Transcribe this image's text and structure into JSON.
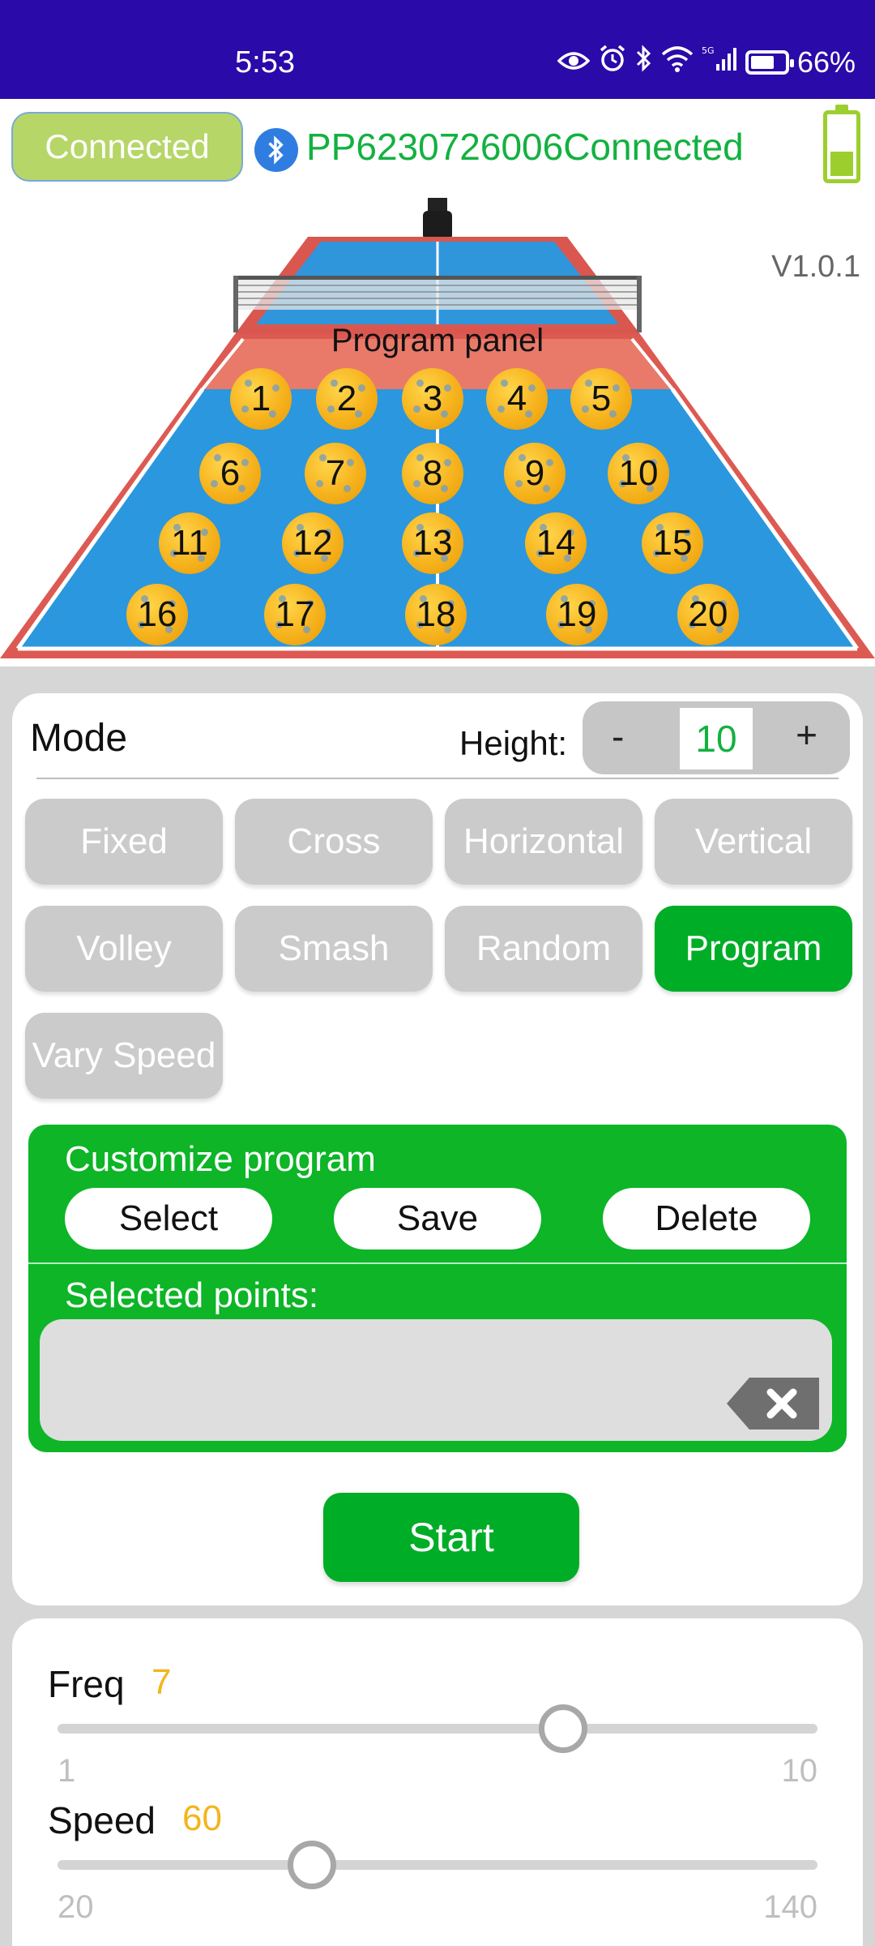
{
  "status_bar": {
    "time": "5:53",
    "battery_percent": "66%",
    "icons": [
      "eye-icon",
      "alarm-icon",
      "bluetooth-icon",
      "wifi-icon",
      "5g-signal-icon",
      "battery-icon"
    ]
  },
  "connection": {
    "status_label": "Connected",
    "device_text": "PP6230726006Connected",
    "battery_level": 0.38
  },
  "court": {
    "version": "V1.0.1",
    "title": "Program panel",
    "points": [
      "1",
      "2",
      "3",
      "4",
      "5",
      "6",
      "7",
      "8",
      "9",
      "10",
      "11",
      "12",
      "13",
      "14",
      "15",
      "16",
      "17",
      "18",
      "19",
      "20"
    ]
  },
  "mode_card": {
    "mode_label": "Mode",
    "height_label": "Height:",
    "height_minus": "-",
    "height_value": "10",
    "height_plus": "+",
    "modes": [
      {
        "label": "Fixed",
        "active": false
      },
      {
        "label": "Cross",
        "active": false
      },
      {
        "label": "Horizontal",
        "active": false
      },
      {
        "label": "Vertical",
        "active": false
      },
      {
        "label": "Volley",
        "active": false
      },
      {
        "label": "Smash",
        "active": false
      },
      {
        "label": "Random",
        "active": false
      },
      {
        "label": "Program",
        "active": true
      },
      {
        "label": "Vary Speed",
        "active": false
      }
    ],
    "customize": {
      "title": "Customize program",
      "select_label": "Select",
      "save_label": "Save",
      "delete_label": "Delete",
      "selected_points_label": "Selected points:",
      "selected_points_value": ""
    },
    "start_label": "Start"
  },
  "sliders": [
    {
      "name": "Freq",
      "value": "7",
      "min": "1",
      "max": "10"
    },
    {
      "name": "Speed",
      "value": "60",
      "min": "20",
      "max": "140"
    }
  ],
  "colors": {
    "status_bar": "#2a0aa8",
    "accent_green": "#00ad27",
    "connected_pill": "#b6d668",
    "slider_value": "#f2b51c"
  }
}
